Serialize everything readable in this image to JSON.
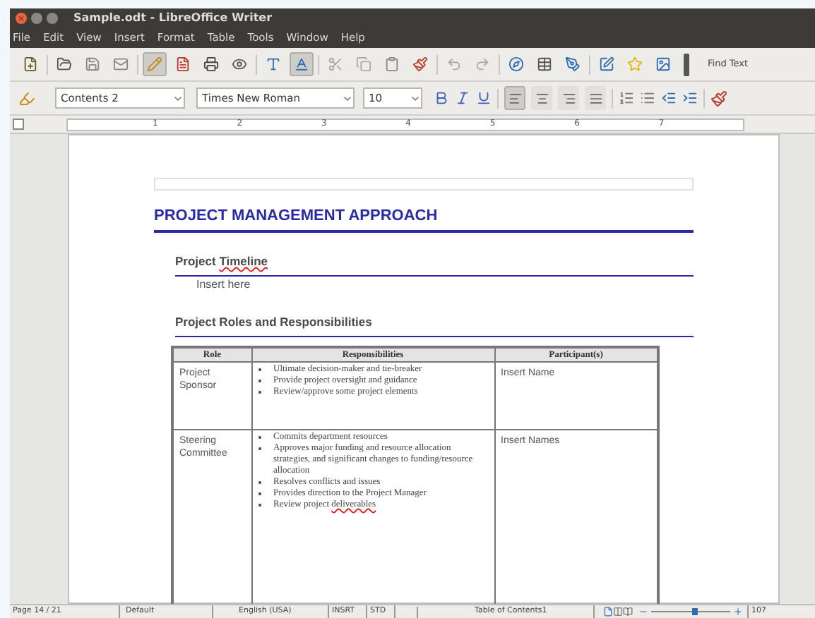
{
  "window": {
    "title": "Sample.odt - LibreOffice Writer"
  },
  "menu": [
    "File",
    "Edit",
    "View",
    "Insert",
    "Format",
    "Table",
    "Tools",
    "Window",
    "Help"
  ],
  "standard_toolbar": {
    "buttons": [
      {
        "pressed": false
      },
      {
        "pressed": false
      },
      {
        "pressed": false
      },
      {
        "pressed": false
      },
      {
        "pressed": true
      },
      {
        "pressed": false
      },
      {
        "pressed": false
      },
      {
        "pressed": false
      },
      {
        "pressed": false
      },
      {
        "pressed": true
      },
      {
        "pressed": false
      },
      {
        "pressed": false
      },
      {
        "pressed": false
      },
      {
        "pressed": false
      },
      {
        "pressed": false
      },
      {
        "pressed": false
      },
      {
        "pressed": false
      },
      {
        "pressed": false
      },
      {
        "pressed": false
      },
      {
        "pressed": false
      },
      {
        "pressed": false
      },
      {
        "pressed": false
      }
    ],
    "find_label": "Find Text"
  },
  "formatting_toolbar": {
    "style": "Contents 2",
    "font": "Times New Roman",
    "size": "10",
    "alignment": [
      {
        "selected": true
      },
      {
        "selected": false
      },
      {
        "selected": false
      },
      {
        "selected": false
      }
    ]
  },
  "ruler": {
    "marks": [
      "1",
      "2",
      "3",
      "4",
      "5",
      "6",
      "7"
    ]
  },
  "document": {
    "title": "PROJECT MANAGEMENT APPROACH",
    "sections": [
      {
        "heading": {
          "text": "Project ",
          "misspelled": "Timeline"
        },
        "body": "Insert here"
      },
      {
        "heading": {
          "text": "Project Roles and Responsibilities"
        }
      }
    ],
    "table": {
      "columns": [
        "Role",
        "Responsibilities",
        "Participant(s)"
      ],
      "rows": [
        {
          "role": "Project Sponsor",
          "responsibilities": [
            {
              "text": "Ultimate decision-maker and tie-breaker"
            },
            {
              "text": "Provide project oversight and guidance"
            },
            {
              "text": "Review/approve some project elements"
            }
          ],
          "participants": "Insert Name"
        },
        {
          "role": "Steering Committee",
          "responsibilities": [
            {
              "text": "Commits department resources"
            },
            {
              "text": "Approves major funding and resource allocation strategies, and significant changes to funding/resource allocation"
            },
            {
              "text": "Resolves conflicts and issues"
            },
            {
              "text": "Provides direction to the Project Manager"
            },
            {
              "text": "Review project ",
              "misspelled": "deliverables"
            }
          ],
          "participants": "Insert Names"
        }
      ]
    }
  },
  "status_bar": {
    "page": "Page 14 / 21",
    "page_style": "Default",
    "language": "English (USA)",
    "insert_mode": "INSRT",
    "selection_mode": "STD",
    "section": "Table of Contents1",
    "zoom": {
      "level": 0.55,
      "reading": "107"
    }
  }
}
